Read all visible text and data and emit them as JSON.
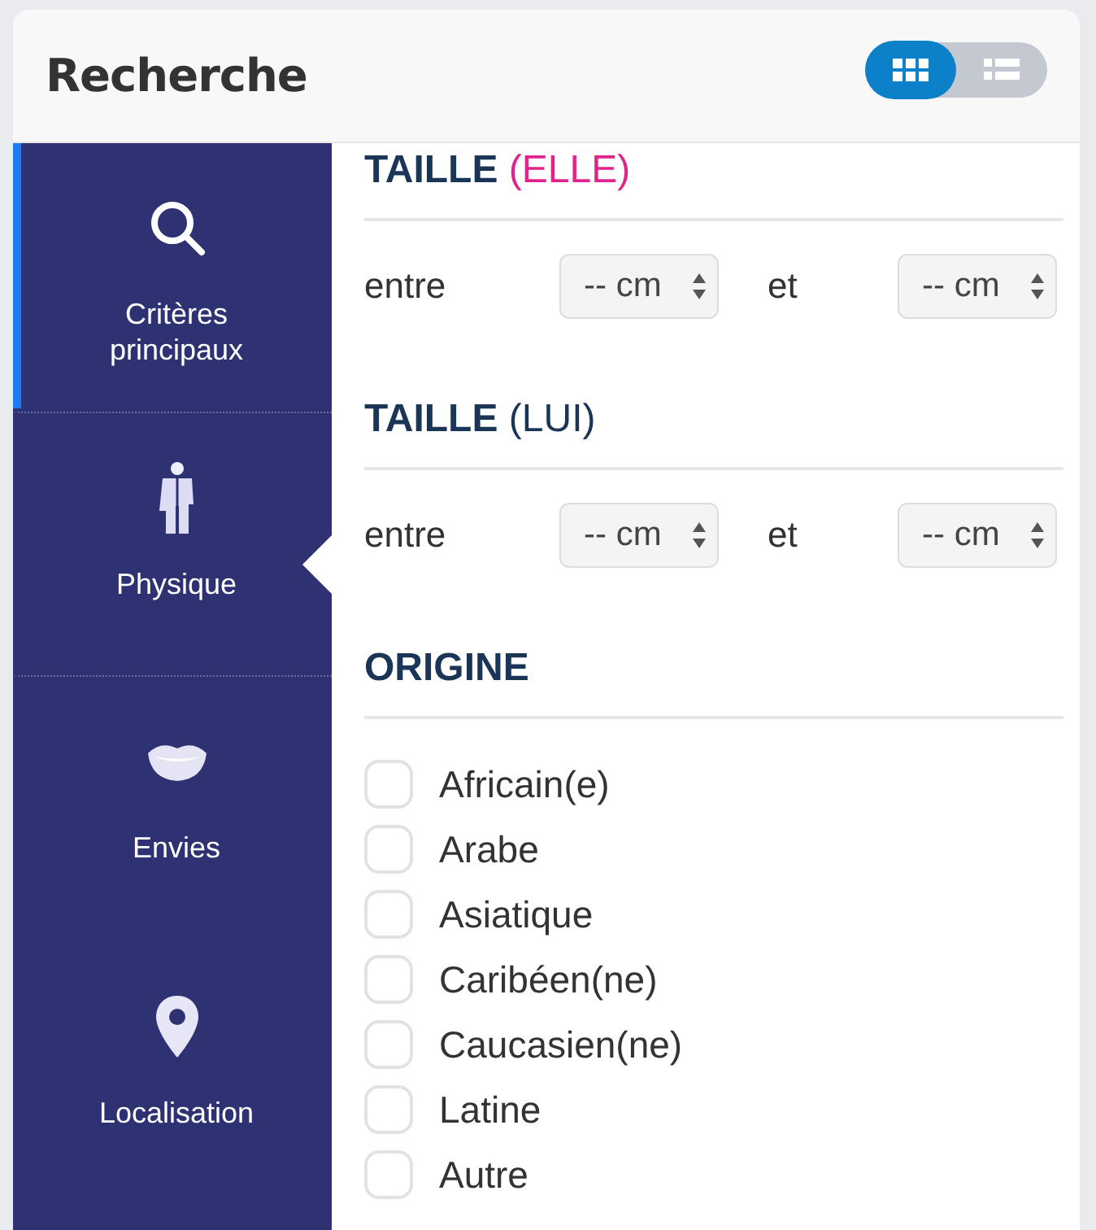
{
  "header": {
    "title": "Recherche",
    "view_toggle": [
      {
        "kind": "grid",
        "selected": true
      },
      {
        "kind": "list",
        "selected": false
      }
    ]
  },
  "sidebar": {
    "items": [
      {
        "label": "Critères principaux",
        "kind": "search",
        "selected": false,
        "accent": true
      },
      {
        "label": "Physique",
        "kind": "person",
        "selected": true,
        "accent": false
      },
      {
        "label": "Envies",
        "kind": "lips",
        "selected": false,
        "accent": false
      },
      {
        "label": "Localisation",
        "kind": "pin",
        "selected": false,
        "accent": false
      }
    ]
  },
  "sections": [
    {
      "title": "TAILLE",
      "note": "(ELLE)",
      "color": "#e0248c",
      "kind": "range",
      "from_label": "entre",
      "from_value": "-- cm",
      "to_label": "et",
      "to_value": "-- cm"
    },
    {
      "title": "TAILLE",
      "note": "(LUI)",
      "color": "#1b3556",
      "kind": "range",
      "from_label": "entre",
      "from_value": "-- cm",
      "to_label": "et",
      "to_value": "-- cm"
    },
    {
      "title": "ORIGINE",
      "kind": "checklist",
      "options": [
        {
          "label": "Africain(e)",
          "checked": false
        },
        {
          "label": "Arabe",
          "checked": false
        },
        {
          "label": "Asiatique",
          "checked": false
        },
        {
          "label": "Caribéen(ne)",
          "checked": false
        },
        {
          "label": "Caucasien(ne)",
          "checked": false
        },
        {
          "label": "Latine",
          "checked": false
        },
        {
          "label": "Autre",
          "checked": false
        }
      ]
    }
  ]
}
